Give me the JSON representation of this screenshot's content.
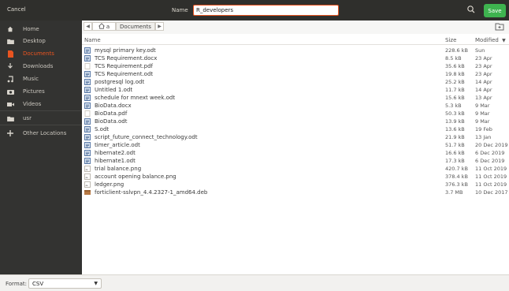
{
  "header": {
    "cancel_label": "Cancel",
    "name_label": "Name",
    "name_value": "R_developers",
    "save_label": "Save"
  },
  "sidebar": {
    "items": [
      {
        "label": "Home",
        "icon": "home-icon"
      },
      {
        "label": "Desktop",
        "icon": "folder-icon"
      },
      {
        "label": "Documents",
        "icon": "documents-icon",
        "active": true
      },
      {
        "label": "Downloads",
        "icon": "download-icon"
      },
      {
        "label": "Music",
        "icon": "music-icon"
      },
      {
        "label": "Pictures",
        "icon": "camera-icon"
      },
      {
        "label": "Videos",
        "icon": "video-icon"
      },
      {
        "label": "usr",
        "icon": "folder-icon"
      },
      {
        "label": "Other Locations",
        "icon": "plus-icon"
      }
    ]
  },
  "pathbar": {
    "home_label": "a",
    "current_folder": "Documents"
  },
  "columns": {
    "name": "Name",
    "size": "Size",
    "modified": "Modified"
  },
  "files": [
    {
      "name": "mysql primary key.odt",
      "size": "228.6 kB",
      "modified": "Sun",
      "type": "odt"
    },
    {
      "name": "TCS Requirement.docx",
      "size": "8.5 kB",
      "modified": "23 Apr",
      "type": "docx"
    },
    {
      "name": "TCS Requirement.pdf",
      "size": "35.6 kB",
      "modified": "23 Apr",
      "type": "pdf"
    },
    {
      "name": "TCS Requirement.odt",
      "size": "19.8 kB",
      "modified": "23 Apr",
      "type": "odt"
    },
    {
      "name": "postgresql log.odt",
      "size": "25.2 kB",
      "modified": "14 Apr",
      "type": "odt"
    },
    {
      "name": "Untitled 1.odt",
      "size": "11.7 kB",
      "modified": "14 Apr",
      "type": "odt"
    },
    {
      "name": "schedule for mnext week.odt",
      "size": "15.6 kB",
      "modified": "13 Apr",
      "type": "odt"
    },
    {
      "name": "BioData.docx",
      "size": "5.3 kB",
      "modified": "9 Mar",
      "type": "docx"
    },
    {
      "name": "BioData.pdf",
      "size": "50.3 kB",
      "modified": "9 Mar",
      "type": "pdf"
    },
    {
      "name": "BioData.odt",
      "size": "13.9 kB",
      "modified": "9 Mar",
      "type": "odt"
    },
    {
      "name": "S.odt",
      "size": "13.6 kB",
      "modified": "19 Feb",
      "type": "odt"
    },
    {
      "name": "script_future_connect_technology.odt",
      "size": "21.9 kB",
      "modified": "13 Jan",
      "type": "odt"
    },
    {
      "name": "timer_article.odt",
      "size": "51.7 kB",
      "modified": "20 Dec 2019",
      "type": "odt"
    },
    {
      "name": "hibernate2.odt",
      "size": "16.6 kB",
      "modified": "6 Dec 2019",
      "type": "odt"
    },
    {
      "name": "hibernate1.odt",
      "size": "17.3 kB",
      "modified": "6 Dec 2019",
      "type": "odt"
    },
    {
      "name": "trial balance.png",
      "size": "420.7 kB",
      "modified": "11 Oct 2019",
      "type": "png"
    },
    {
      "name": "account opening balance.png",
      "size": "378.4 kB",
      "modified": "11 Oct 2019",
      "type": "png"
    },
    {
      "name": "ledger.png",
      "size": "376.3 kB",
      "modified": "11 Oct 2019",
      "type": "png"
    },
    {
      "name": "forticlient-sslvpn_4.4.2327-1_amd64.deb",
      "size": "3.7 MB",
      "modified": "10 Dec 2017",
      "type": "deb"
    }
  ],
  "footer": {
    "format_label": "Format:",
    "format_value": "CSV"
  },
  "colors": {
    "accent": "#e95420",
    "save": "#3eb34f",
    "sidebar_bg": "#333331",
    "topbar_bg": "#2f2f2c"
  }
}
